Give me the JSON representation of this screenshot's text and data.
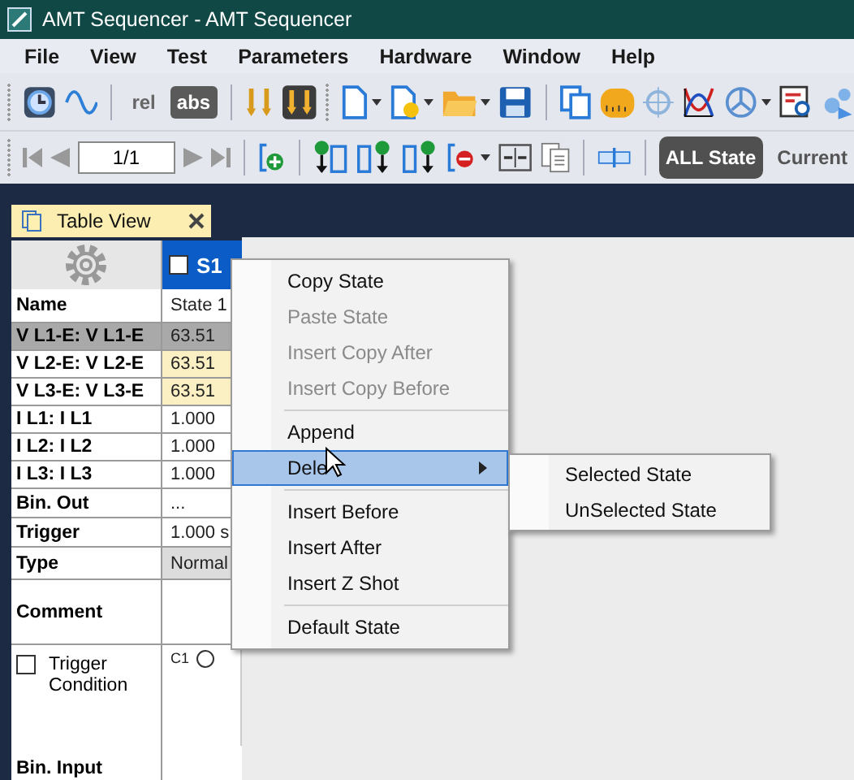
{
  "window": {
    "title": "AMT Sequencer - AMT Sequencer"
  },
  "menu_bar": [
    {
      "label": "File"
    },
    {
      "label": "View"
    },
    {
      "label": "Test"
    },
    {
      "label": "Parameters"
    },
    {
      "label": "Hardware"
    },
    {
      "label": "Window"
    },
    {
      "label": "Help"
    }
  ],
  "toolbar": {
    "mode_buttons": [
      {
        "label": "rel",
        "selected": false
      },
      {
        "label": "abs",
        "selected": true
      }
    ]
  },
  "navigation_bar": {
    "page": "1/1",
    "view_buttons": [
      {
        "label": "ALL State",
        "selected": true
      },
      {
        "label": "Current",
        "selected": false
      }
    ]
  },
  "document_tab": {
    "title": "Table View"
  },
  "table": {
    "column": {
      "label": "S1",
      "checked": false
    },
    "rows": [
      {
        "kind": "text",
        "label": "Name",
        "value": "State 1",
        "selected": false,
        "highlighted": false
      },
      {
        "kind": "text",
        "label": "V L1-E: V L1-E",
        "value": "63.51",
        "selected": true,
        "highlighted": false
      },
      {
        "kind": "text",
        "label": "V L2-E: V L2-E",
        "value": "63.51",
        "selected": false,
        "highlighted": true
      },
      {
        "kind": "text",
        "label": "V L3-E: V L3-E",
        "value": "63.51",
        "selected": false,
        "highlighted": true
      },
      {
        "kind": "text",
        "label": "I L1: I L1",
        "value": "1.000",
        "selected": false,
        "highlighted": false
      },
      {
        "kind": "text",
        "label": "I L2: I L2",
        "value": "1.000",
        "selected": false,
        "highlighted": false
      },
      {
        "kind": "text",
        "label": "I L3: I L3",
        "value": "1.000",
        "selected": false,
        "highlighted": false
      },
      {
        "kind": "text",
        "label": "Bin. Out",
        "value": "...",
        "selected": false,
        "highlighted": false
      },
      {
        "kind": "text",
        "label": "Trigger",
        "value": "1.000 s",
        "selected": false,
        "highlighted": false
      },
      {
        "kind": "combo",
        "label": "Type",
        "value": "Normal",
        "selected": false,
        "highlighted": false
      },
      {
        "kind": "tall",
        "label": "Comment",
        "value": "",
        "selected": false,
        "highlighted": false
      },
      {
        "kind": "condition",
        "label": "Trigger Condition",
        "checked": false,
        "value": "C1",
        "selected": false,
        "highlighted": false
      },
      {
        "kind": "bottom",
        "label": "Bin. Input",
        "selected": false
      }
    ]
  },
  "context_menu": {
    "items": [
      {
        "kind": "item",
        "label": "Copy State",
        "disabled": false,
        "selected": false,
        "submenu": false
      },
      {
        "kind": "item",
        "label": "Paste State",
        "disabled": true,
        "selected": false,
        "submenu": false
      },
      {
        "kind": "item",
        "label": "Insert Copy After",
        "disabled": true,
        "selected": false,
        "submenu": false
      },
      {
        "kind": "item",
        "label": "Insert Copy Before",
        "disabled": true,
        "selected": false,
        "submenu": false
      },
      {
        "kind": "separator"
      },
      {
        "kind": "item",
        "label": "Append",
        "disabled": false,
        "selected": false,
        "submenu": false
      },
      {
        "kind": "item",
        "label": "Dele",
        "disabled": false,
        "selected": true,
        "submenu": true
      },
      {
        "kind": "separator"
      },
      {
        "kind": "item",
        "label": "Insert Before",
        "disabled": false,
        "selected": false,
        "submenu": false
      },
      {
        "kind": "item",
        "label": "Insert After",
        "disabled": false,
        "selected": false,
        "submenu": false
      },
      {
        "kind": "item",
        "label": "Insert Z Shot",
        "disabled": false,
        "selected": false,
        "submenu": false
      },
      {
        "kind": "separator"
      },
      {
        "kind": "item",
        "label": "Default State",
        "disabled": false,
        "selected": false,
        "submenu": false
      }
    ],
    "submenu": [
      {
        "label": "Selected State"
      },
      {
        "label": "UnSelected State"
      }
    ]
  }
}
